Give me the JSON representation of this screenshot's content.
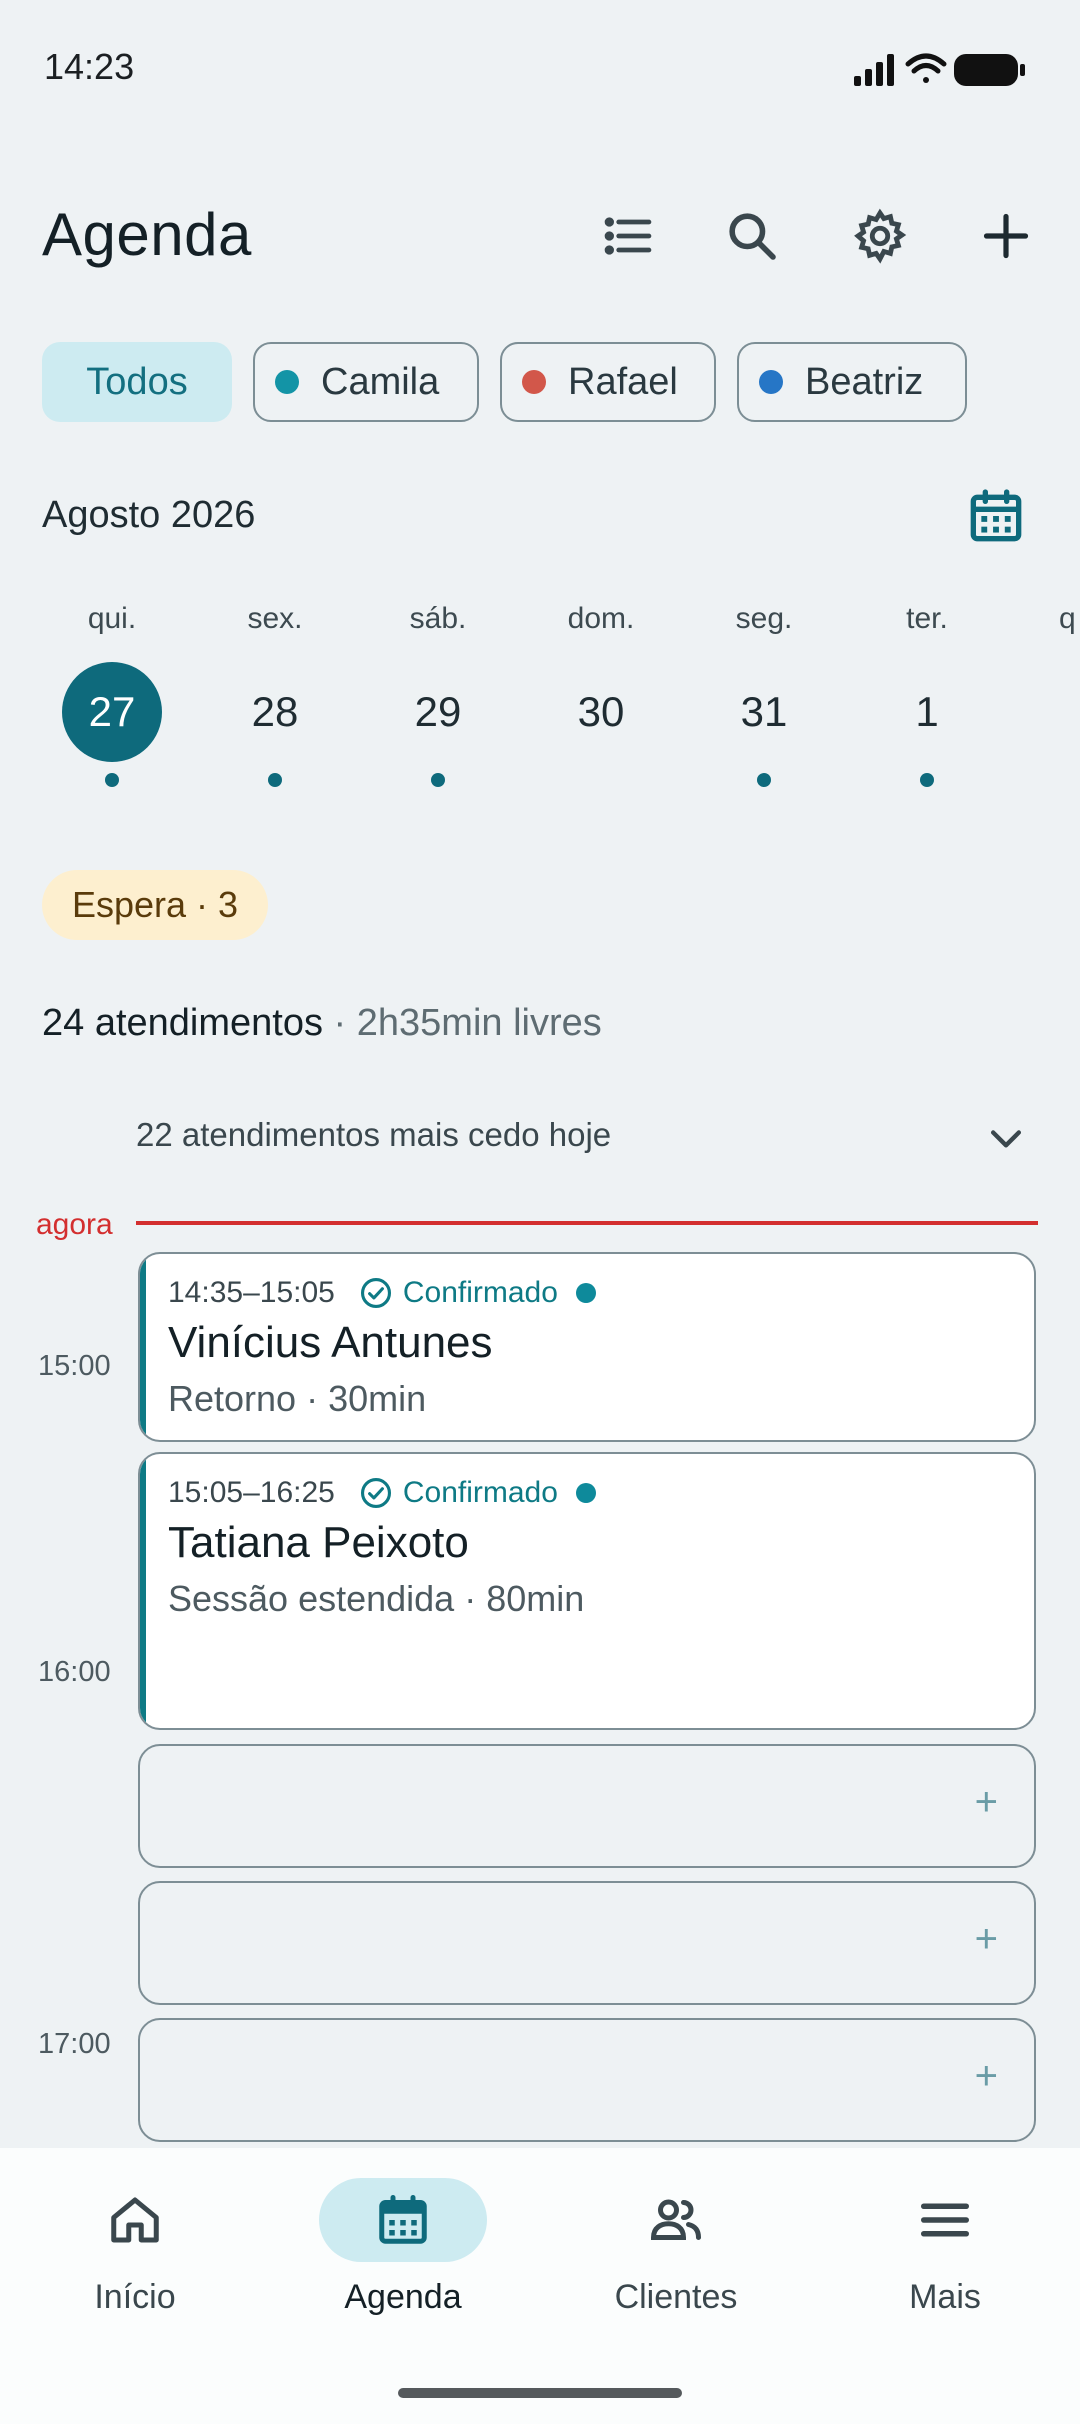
{
  "status_bar": {
    "time": "14:23"
  },
  "header": {
    "title": "Agenda",
    "icons": [
      "list-icon",
      "search-icon",
      "settings-icon",
      "add-icon"
    ]
  },
  "filters": {
    "chips": [
      {
        "label": "Todos",
        "selected": true
      },
      {
        "label": "Camila",
        "color": "#1394A6",
        "selected": false
      },
      {
        "label": "Rafael",
        "color": "#D2574A",
        "selected": false
      },
      {
        "label": "Beatriz",
        "color": "#2676C6",
        "selected": false
      }
    ]
  },
  "calendar": {
    "month": "Agosto 2026",
    "days": [
      {
        "weekday": "qui.",
        "day": "27",
        "selected": true,
        "has_events": true
      },
      {
        "weekday": "sex.",
        "day": "28",
        "has_events": true
      },
      {
        "weekday": "sáb.",
        "day": "29",
        "has_events": true
      },
      {
        "weekday": "dom.",
        "day": "30",
        "has_events": false
      },
      {
        "weekday": "seg.",
        "day": "31",
        "has_events": true
      },
      {
        "weekday": "ter.",
        "day": "1",
        "has_events": true
      },
      {
        "weekday": "q",
        "day": "",
        "has_events": false
      }
    ]
  },
  "waiting": {
    "label": "Espera · 3"
  },
  "summary": {
    "count": "24 atendimentos",
    "free": " · 2h35min livres"
  },
  "earlier": {
    "label": "22 atendimentos mais cedo hoje"
  },
  "timeline": {
    "now_label": "agora",
    "hours": [
      "15:00",
      "16:00",
      "17:00"
    ],
    "appointments": [
      {
        "time": "14:35–15:05",
        "status": "Confirmado",
        "name": "Vinícius Antunes",
        "detail": "Retorno · 30min"
      },
      {
        "time": "15:05–16:25",
        "status": "Confirmado",
        "name": "Tatiana Peixoto",
        "detail": "Sessão estendida · 80min"
      }
    ],
    "empty_slot_symbol": "+"
  },
  "bottom_nav": {
    "items": [
      {
        "label": "Início",
        "icon": "home-icon"
      },
      {
        "label": "Agenda",
        "icon": "calendar-icon",
        "active": true
      },
      {
        "label": "Clientes",
        "icon": "people-icon"
      },
      {
        "label": "Mais",
        "icon": "menu-icon"
      }
    ]
  },
  "colors": {
    "primary": "#0E6A7C",
    "accent_light": "#CDEBF1",
    "now": "#D32F2F",
    "waiting_bg": "#FDEFCF"
  }
}
